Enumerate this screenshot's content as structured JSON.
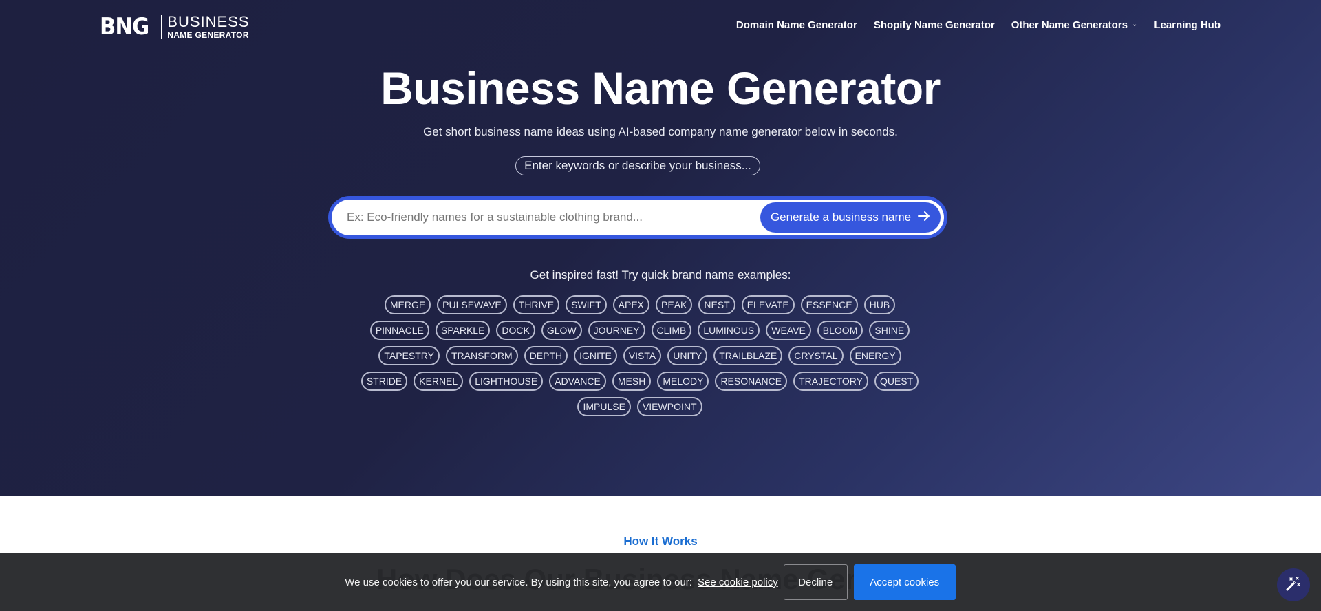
{
  "header": {
    "logo": {
      "mark": "BNG",
      "line1": "BUSINESS",
      "line2": "NAME GENERATOR"
    },
    "nav": [
      {
        "label": "Domain Name Generator",
        "has_dropdown": false
      },
      {
        "label": "Shopify Name Generator",
        "has_dropdown": false
      },
      {
        "label": "Other Name Generators",
        "has_dropdown": true,
        "icon": "chevron-down-icon"
      },
      {
        "label": "Learning Hub",
        "has_dropdown": false
      }
    ]
  },
  "hero": {
    "title": "Business Name Generator",
    "subtitle": "Get short business name ideas using AI-based company name generator below in seconds.",
    "hint": "Enter keywords or describe your business...",
    "search": {
      "value": "",
      "placeholder": "Ex: Eco-friendly names for a sustainable clothing brand...",
      "button_label": "Generate a business name",
      "button_icon": "arrow-right-icon"
    },
    "inspire_text": "Get inspired fast! Try quick brand name examples:",
    "example_rows": [
      [
        "MERGE",
        "PULSEWAVE",
        "THRIVE",
        "SWIFT",
        "APEX",
        "PEAK",
        "NEST",
        "ELEVATE",
        "ESSENCE",
        "HUB"
      ],
      [
        "PINNACLE",
        "SPARKLE",
        "DOCK",
        "GLOW",
        "JOURNEY",
        "CLIMB",
        "LUMINOUS",
        "WEAVE",
        "BLOOM",
        "SHINE"
      ],
      [
        "TAPESTRY",
        "TRANSFORM",
        "DEPTH",
        "IGNITE",
        "VISTA",
        "UNITY",
        "TRAILBLAZE",
        "CRYSTAL",
        "ENERGY"
      ],
      [
        "STRIDE",
        "KERNEL",
        "LIGHTHOUSE",
        "ADVANCE",
        "MESH",
        "MELODY",
        "RESONANCE",
        "TRAJECTORY",
        "QUEST"
      ],
      [
        "IMPULSE",
        "VIEWPOINT"
      ]
    ]
  },
  "how_it_works": {
    "label": "How It Works",
    "heading": "How Does Our Business Name Generator"
  },
  "cookie_banner": {
    "text": "We use cookies to offer you our service. By using this site, you agree to our:",
    "link_label": "See cookie policy",
    "decline_label": "Decline",
    "accept_label": "Accept cookies"
  },
  "floating_button": {
    "icon": "magic-wand-icon"
  },
  "colors": {
    "hero_bg_start": "#1e2040",
    "hero_bg_end": "#3d4785",
    "accent_blue": "#3657de",
    "link_blue": "#1a6dd1",
    "accept_blue": "#1a73e8",
    "cookie_bg": "#28292c"
  }
}
